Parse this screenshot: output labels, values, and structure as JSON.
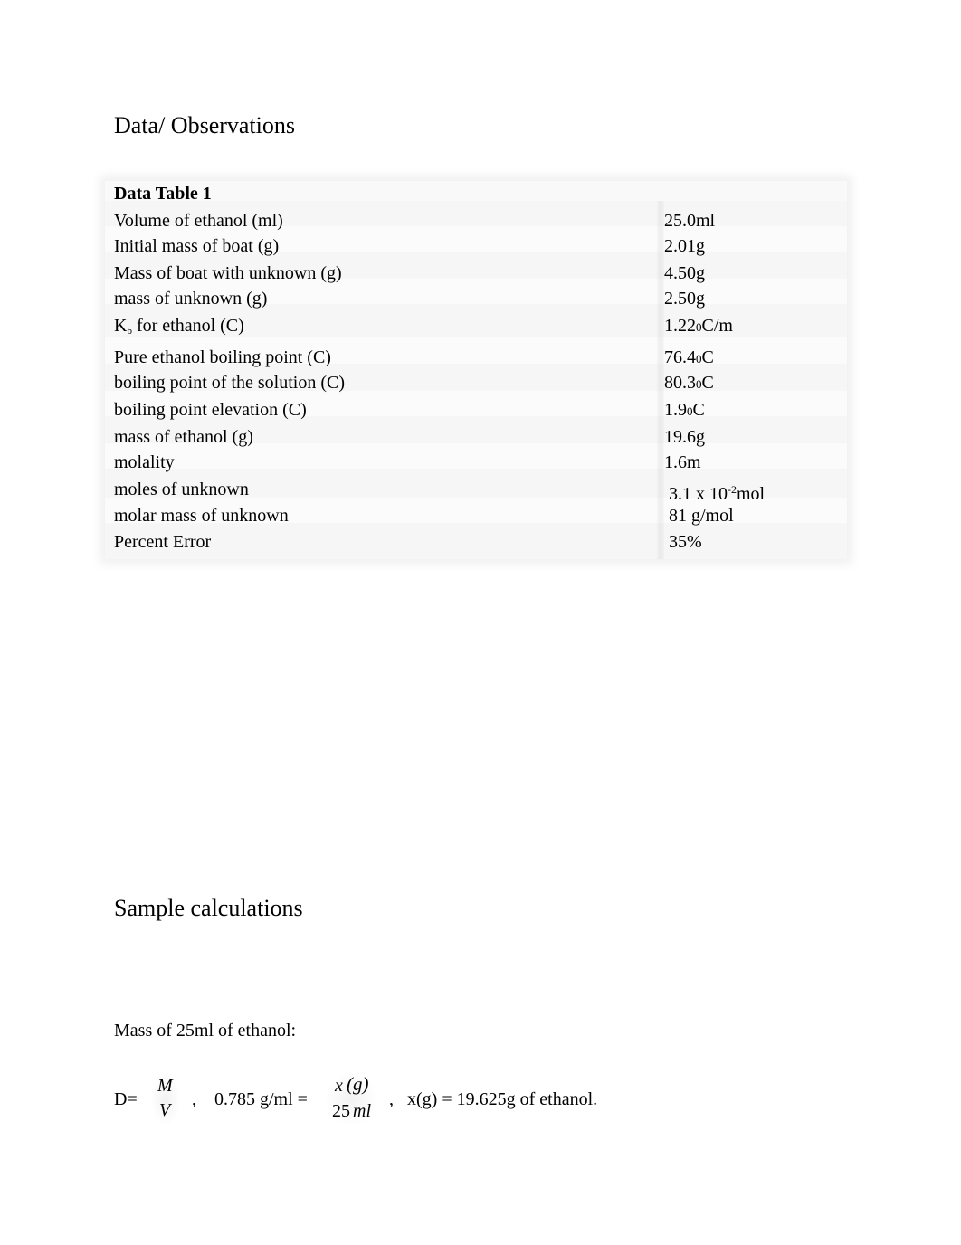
{
  "headings": {
    "data_observations": "Data/ Observations",
    "sample_calculations": "Sample calculations"
  },
  "data_table": {
    "title": "Data Table 1",
    "rows": [
      {
        "label": "Volume of ethanol (ml)",
        "value": "25.0ml"
      },
      {
        "label": "Initial mass of boat (g)",
        "value": "2.01g"
      },
      {
        "label": "Mass of boat with unknown (g)",
        "value": "4.50g"
      },
      {
        "label": "mass of unknown (g)",
        "value": "2.50g"
      },
      {
        "label_prefix": "K",
        "label_sub": "b",
        "label_suffix": " for ethanol (C)",
        "value_prefix": "1.22",
        "value_sup": "0",
        "value_suffix": "C/m"
      },
      {
        "label": "Pure ethanol boiling point (C)",
        "value_prefix": "76.4",
        "value_sup": "0",
        "value_suffix": "C"
      },
      {
        "label": "boiling point of the solution (C)",
        "value_prefix": "80.3",
        "value_sup": "0",
        "value_suffix": "C"
      },
      {
        "label": "boiling point elevation (C)",
        "value_prefix": "1.9",
        "value_sup": "0",
        "value_suffix": "C"
      },
      {
        "label": "mass of ethanol (g)",
        "value": "19.6g"
      },
      {
        "label": "molality",
        "value": "1.6m"
      },
      {
        "label": "moles of unknown",
        "value_prefix": "3.1 x 10",
        "value_sup": "-2",
        "value_suffix": "mol"
      },
      {
        "label": "molar mass of unknown",
        "value": "81 g/mol"
      },
      {
        "label": "Percent Error",
        "value": "35%"
      }
    ]
  },
  "sample_calculations": {
    "mass_label": "Mass of 25ml of ethanol:",
    "equation": {
      "d_eq": "D=",
      "frac1_num": "M",
      "frac1_den": "V",
      "comma1": ",",
      "density_eq": "0.785 g/ml =",
      "frac2_num": "x",
      "frac2_num_paren": "(g)",
      "frac2_den_num": "25",
      "frac2_den_unit": "ml",
      "comma2": ",",
      "result": "x(g) = 19.625g of ethanol."
    }
  }
}
